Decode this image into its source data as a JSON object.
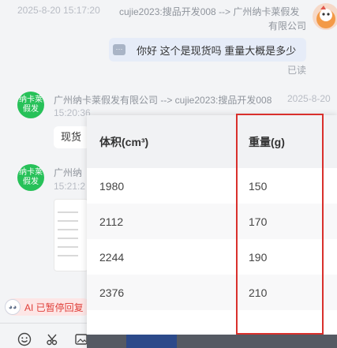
{
  "messages": {
    "top_header": {
      "timestamp": "2025-8-20 15:17:20",
      "route_line1": "cujie2023:搜品开发008 --> 广州纳卡莱假发",
      "route_line2": "有限公司"
    },
    "outgoing": {
      "text": "你好 这个是现货吗 重量大概是多少",
      "status": "已读",
      "icon_text": "···"
    },
    "reply1": {
      "avatar_text": "纳卡莱假发",
      "route": "广州纳卡莱假发有限公司 --> cujie2023:搜品开发008",
      "timestamp_part1": "2025-8-20",
      "timestamp_part2": "15:20:36",
      "text": "现货"
    },
    "reply2": {
      "avatar_text": "纳卡莱假发",
      "route": "广州纳",
      "timestamp_part2": "15:21:2"
    }
  },
  "ai_status": {
    "label": "AI 已暂停回复",
    "robot_icon": "robot-icon"
  },
  "toolbar": {
    "icons": [
      "smile-icon",
      "scissors-icon",
      "image-icon"
    ]
  },
  "table": {
    "headers": [
      "体积(cm³)",
      "重量(g)"
    ],
    "rows": [
      [
        "1980",
        "150"
      ],
      [
        "2112",
        "170"
      ],
      [
        "2244",
        "190"
      ],
      [
        "2376",
        "210"
      ]
    ]
  },
  "colors": {
    "accent_red": "#d9302c",
    "avatar_green": "#27c159",
    "bubble_blue": "#e6ecf8"
  }
}
